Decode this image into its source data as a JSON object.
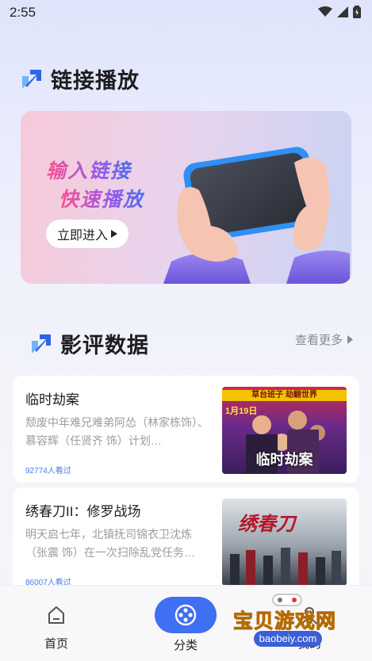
{
  "status_bar": {
    "time": "2:55"
  },
  "link_section": {
    "title": "链接播放"
  },
  "banner": {
    "line1": "输入链接",
    "line2": "快速播放",
    "button_label": "立即进入"
  },
  "review_section": {
    "title": "影评数据",
    "more_label": "查看更多"
  },
  "reviews": [
    {
      "title": "临时劫案",
      "desc": "颓废中年难兄难弟阿怂（林家栋饰）、慕容辉（任贤齐 饰）计划…",
      "views": "92774人看过",
      "poster_caption": "临时劫案",
      "poster_top": "草台班子 劫翻世界",
      "poster_date": "1月19日"
    },
    {
      "title": "绣春刀II：修罗战场",
      "desc": "明天启七年，北镇抚司锦衣卫沈炼（张震 饰）在一次扫除乱党任务…",
      "views": "86007人看过",
      "poster_caption": "绣春刀"
    }
  ],
  "tabbar": {
    "tabs": [
      {
        "label": "首页",
        "icon": "home-icon"
      },
      {
        "label": "分类",
        "icon": "film-reel-icon"
      },
      {
        "label": "我的",
        "icon": "user-icon"
      }
    ],
    "active_index": 1
  },
  "watermark": {
    "text": "宝贝游戏网",
    "url": "baobeiy.com"
  },
  "colors": {
    "accent": "#3f6ff2",
    "views": "#4d7be8",
    "muted": "#9c9ca2"
  }
}
